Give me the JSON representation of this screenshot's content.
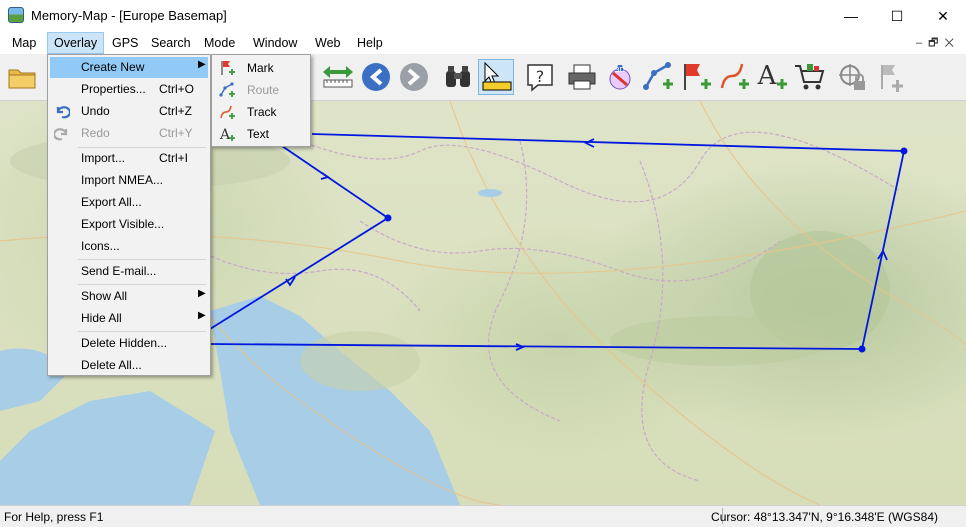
{
  "window": {
    "title": "Memory-Map - [Europe Basemap]",
    "controls": {
      "minimize": "—",
      "maximize": "☐",
      "close": "✕"
    }
  },
  "menubar": {
    "items": [
      "Map",
      "Overlay",
      "GPS",
      "Search",
      "Mode",
      "Window",
      "Web",
      "Help"
    ],
    "active": "Overlay",
    "mdi_controls": [
      "–",
      "🗗",
      "✕"
    ]
  },
  "toolbar": {
    "buttons": [
      "open-folder-icon",
      "swap-arrows-icon",
      "back-arrow-icon",
      "forward-arrow-icon",
      "binoculars-icon",
      "select-cursor-icon",
      "help-icon",
      "print-icon",
      "gps-icon",
      "new-route-icon",
      "new-mark-icon",
      "new-track-icon",
      "new-text-icon",
      "shop-cart-icon",
      "lock-position-icon",
      "unlock-icon"
    ],
    "pressed": "select-cursor-icon"
  },
  "overlay_menu": {
    "items": [
      {
        "label": "Create New",
        "shortcut": "",
        "submenu": true,
        "disabled": false,
        "icon": ""
      },
      {
        "label": "Properties...",
        "shortcut": "Ctrl+O",
        "submenu": false,
        "disabled": false,
        "icon": ""
      },
      {
        "label": "Undo",
        "shortcut": "Ctrl+Z",
        "submenu": false,
        "disabled": false,
        "icon": "undo-icon"
      },
      {
        "label": "Redo",
        "shortcut": "Ctrl+Y",
        "submenu": false,
        "disabled": true,
        "icon": "redo-icon"
      },
      {
        "label": "Import...",
        "shortcut": "Ctrl+I",
        "submenu": false,
        "disabled": false,
        "icon": ""
      },
      {
        "label": "Import NMEA...",
        "shortcut": "",
        "submenu": false,
        "disabled": false,
        "icon": ""
      },
      {
        "label": "Export All...",
        "shortcut": "",
        "submenu": false,
        "disabled": false,
        "icon": ""
      },
      {
        "label": "Export Visible...",
        "shortcut": "",
        "submenu": false,
        "disabled": false,
        "icon": ""
      },
      {
        "label": "Icons...",
        "shortcut": "",
        "submenu": false,
        "disabled": false,
        "icon": ""
      },
      {
        "label": "Send E-mail...",
        "shortcut": "",
        "submenu": false,
        "disabled": false,
        "icon": ""
      },
      {
        "label": "Show All",
        "shortcut": "",
        "submenu": true,
        "disabled": false,
        "icon": ""
      },
      {
        "label": "Hide All",
        "shortcut": "",
        "submenu": true,
        "disabled": false,
        "icon": ""
      },
      {
        "label": "Delete Hidden...",
        "shortcut": "",
        "submenu": false,
        "disabled": false,
        "icon": ""
      },
      {
        "label": "Delete All...",
        "shortcut": "",
        "submenu": false,
        "disabled": false,
        "icon": ""
      }
    ],
    "highlighted": "Create New",
    "submenu_arrow": "▶"
  },
  "create_new_submenu": {
    "items": [
      {
        "label": "Mark",
        "icon": "mark-flag-icon"
      },
      {
        "label": "Route",
        "icon": "route-icon"
      },
      {
        "label": "Track",
        "icon": "track-icon"
      },
      {
        "label": "Text",
        "icon": "text-icon"
      }
    ]
  },
  "map": {
    "route_color": "#0018e0"
  },
  "statusbar": {
    "help_text": "For Help, press F1",
    "cursor_text": "Cursor: 48°13.347'N, 9°16.348'E (WGS84)"
  }
}
